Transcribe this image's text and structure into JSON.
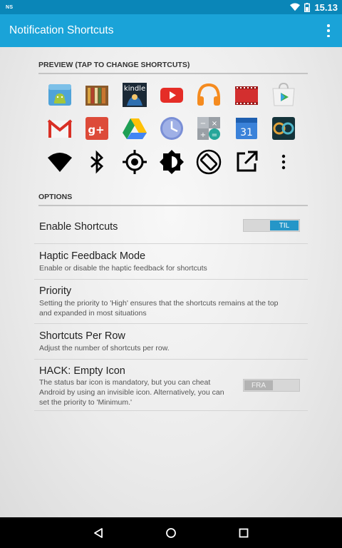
{
  "status_bar": {
    "left_text": "NS",
    "time": "15.13"
  },
  "action_bar": {
    "title": "Notification Shortcuts"
  },
  "preview": {
    "header": "PREVIEW (TAP TO CHANGE SHORTCUTS)",
    "rows": [
      [
        "android-app-icon",
        "books-app-icon",
        "kindle-app-icon",
        "youtube-app-icon",
        "music-app-icon",
        "movies-app-icon",
        "play-store-icon"
      ],
      [
        "gmail-app-icon",
        "google-plus-app-icon",
        "drive-app-icon",
        "clock-app-icon",
        "calculator-app-icon",
        "calendar-app-icon",
        "game-app-icon"
      ],
      [
        "wifi-icon",
        "bluetooth-icon",
        "location-icon",
        "brightness-icon",
        "rotation-icon",
        "open-external-icon",
        "more-icon"
      ]
    ],
    "kindle_label": "kindle",
    "calendar_label": "31"
  },
  "options": {
    "header": "OPTIONS",
    "enable_shortcuts": {
      "title": "Enable Shortcuts",
      "toggle": "TIL",
      "state": "on"
    },
    "haptic": {
      "title": "Haptic Feedback Mode",
      "summary": "Enable or disable the haptic feedback for shortcuts"
    },
    "priority": {
      "title": "Priority",
      "summary": "Setting the priority to 'High' ensures that the shortcuts remains at the top and expanded in most situations"
    },
    "per_row": {
      "title": "Shortcuts Per Row",
      "summary": "Adjust the number of shortcuts per row."
    },
    "hack": {
      "title": "HACK: Empty Icon",
      "summary": "The status bar icon is mandatory, but you can cheat Android by using an invisible icon. Alternatively, you can set the priority to 'Minimum.'",
      "toggle": "FRA",
      "state": "off"
    }
  },
  "colors": {
    "status_bar": "#0a86b8",
    "action_bar": "#1aa3d8",
    "toggle_on": "#2596c8"
  },
  "nav": [
    "back-icon",
    "home-icon",
    "recents-icon"
  ]
}
